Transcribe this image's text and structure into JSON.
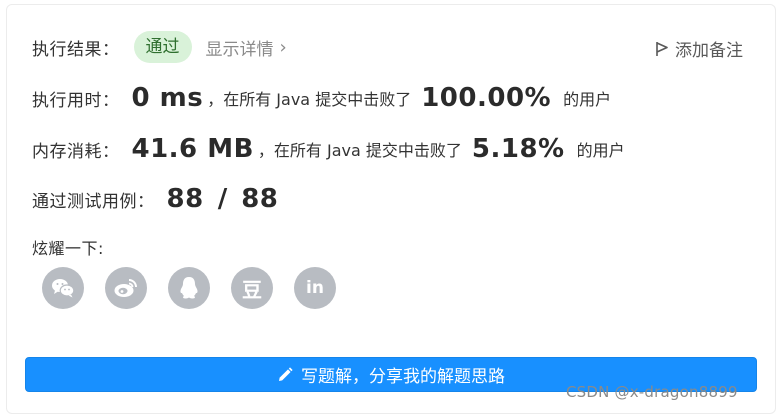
{
  "result": {
    "label": "执行结果：",
    "status": "通过",
    "details_link": "显示详情",
    "details_chevron": "›",
    "add_note": "添加备注"
  },
  "runtime": {
    "label": "执行用时：",
    "value": "0 ms",
    "middle_text": "，在所有 Java 提交中击败了",
    "percent": "100.00%",
    "suffix": "的用户"
  },
  "memory": {
    "label": "内存消耗：",
    "value": "41.6 MB",
    "middle_text": "，在所有 Java 提交中击败了",
    "percent": "5.18%",
    "suffix": "的用户"
  },
  "tests": {
    "label": "通过测试用例：",
    "passed": "88",
    "separator": "/",
    "total": "88"
  },
  "share": {
    "label": "炫耀一下:",
    "icons": [
      "wechat-icon",
      "weibo-icon",
      "qq-icon",
      "douban-icon",
      "linkedin-icon"
    ],
    "douban_text": "豆",
    "linkedin_text": "in"
  },
  "write_solution": {
    "label": "写题解，分享我的解题思路"
  },
  "watermark": "CSDN @x-dragon8899",
  "colors": {
    "accent": "#1890ff",
    "badge_bg": "#d9f2d9",
    "badge_text": "#2f6f2f",
    "icon_bg": "#b8bcc2"
  }
}
